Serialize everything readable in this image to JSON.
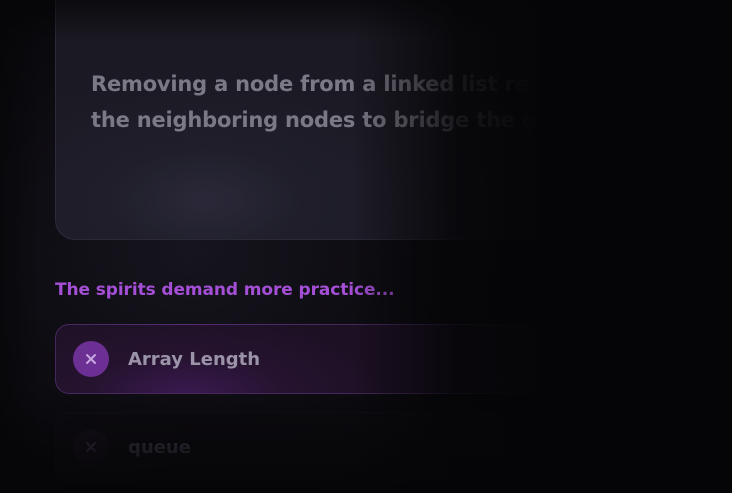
{
  "explanation": {
    "text_line_1": "Removing a node from a linked list re",
    "text_line_2": "the neighboring nodes to bridge the g"
  },
  "practice": {
    "heading": "The spirits demand more practice...",
    "topics": [
      {
        "label": "Array Length",
        "icon": "close-icon",
        "status": "incorrect"
      },
      {
        "label": "queue",
        "icon": "close-icon",
        "status": "incorrect"
      }
    ]
  },
  "colors": {
    "accent": "#a44fd6",
    "icon_bg": "#6c2f93",
    "background": "#050507"
  }
}
